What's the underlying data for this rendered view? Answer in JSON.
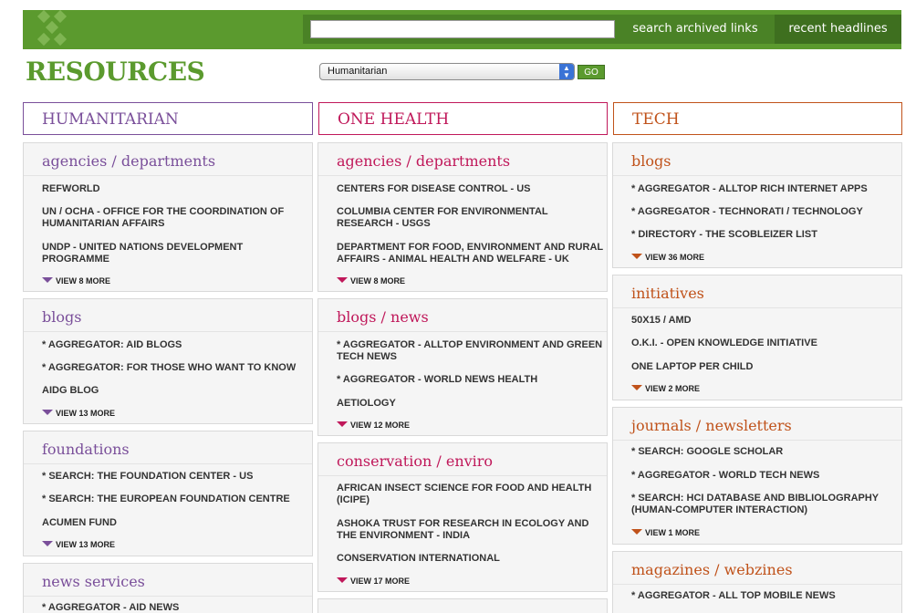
{
  "header": {
    "search_placeholder": "",
    "search_button": "search archived links",
    "recent_button": "recent headlines"
  },
  "page_title": "RESOURCES",
  "filter": {
    "selected": "Humanitarian",
    "go_label": "GO"
  },
  "colors": {
    "brand_green": "#5b9a2e",
    "humanitarian": "#7a4f9a",
    "one_health": "#c0185a",
    "tech": "#c0521a"
  },
  "columns": [
    {
      "title": "HUMANITARIAN",
      "color": "#7a4f9a",
      "sections": [
        {
          "title": "agencies / departments",
          "items": [
            "REFWORLD",
            "UN / OCHA - OFFICE FOR THE COORDINATION OF HUMANITARIAN AFFAIRS",
            "UNDP - UNITED NATIONS DEVELOPMENT PROGRAMME"
          ],
          "more": "VIEW 8 MORE"
        },
        {
          "title": "blogs",
          "items": [
            "* AGGREGATOR: AID BLOGS",
            "* AGGREGATOR: FOR THOSE WHO WANT TO KNOW",
            "AIDG BLOG"
          ],
          "more": "VIEW 13 MORE"
        },
        {
          "title": "foundations",
          "items": [
            "* SEARCH: THE FOUNDATION CENTER - US",
            "* SEARCH: THE EUROPEAN FOUNDATION CENTRE",
            "ACUMEN FUND"
          ],
          "more": "VIEW 13 MORE"
        },
        {
          "title": "news services",
          "items": [
            "* AGGREGATOR - AID NEWS"
          ],
          "more": ""
        }
      ]
    },
    {
      "title": "ONE HEALTH",
      "color": "#c0185a",
      "sections": [
        {
          "title": "agencies / departments",
          "items": [
            "CENTERS FOR DISEASE CONTROL - US",
            "COLUMBIA CENTER FOR ENVIRONMENTAL RESEARCH - USGS",
            "DEPARTMENT FOR FOOD, ENVIRONMENT AND RURAL AFFAIRS - ANIMAL HEALTH AND WELFARE - UK"
          ],
          "more": "VIEW 8 MORE"
        },
        {
          "title": "blogs / news",
          "items": [
            "* AGGREGATOR - ALLTOP ENVIRONMENT AND GREEN TECH NEWS",
            "* AGGREGATOR - WORLD NEWS HEALTH",
            "AETIOLOGY"
          ],
          "more": "VIEW 12 MORE"
        },
        {
          "title": "conservation / enviro",
          "items": [
            "AFRICAN INSECT SCIENCE FOR FOOD AND HEALTH (ICIPE)",
            "ASHOKA TRUST FOR RESEARCH IN ECOLOGY AND THE ENVIRONMENT - INDIA",
            "CONSERVATION INTERNATIONAL"
          ],
          "more": "VIEW 17 MORE"
        },
        {
          "title": "",
          "items": [],
          "more": ""
        }
      ]
    },
    {
      "title": "TECH",
      "color": "#c0521a",
      "sections": [
        {
          "title": "blogs",
          "items": [
            "* AGGREGATOR - ALLTOP RICH INTERNET APPS",
            "* AGGREGATOR - TECHNORATI / TECHNOLOGY",
            "* DIRECTORY - THE SCOBLEIZER LIST"
          ],
          "more": "VIEW 36 MORE"
        },
        {
          "title": "initiatives",
          "items": [
            "50X15 / AMD",
            "O.K.I. - OPEN KNOWLEDGE INITIATIVE",
            "ONE LAPTOP PER CHILD"
          ],
          "more": "VIEW 2 MORE"
        },
        {
          "title": "journals / newsletters",
          "items": [
            "* SEARCH: GOOGLE SCHOLAR",
            "* AGGREGATOR - WORLD TECH NEWS",
            "* SEARCH: HCI DATABASE AND BIBLIOLOGRAPHY (HUMAN-COMPUTER INTERACTION)"
          ],
          "more": "VIEW 1 MORE"
        },
        {
          "title": "magazines / webzines",
          "items": [
            "* AGGREGATOR - ALL TOP MOBILE NEWS"
          ],
          "more": ""
        }
      ]
    }
  ]
}
